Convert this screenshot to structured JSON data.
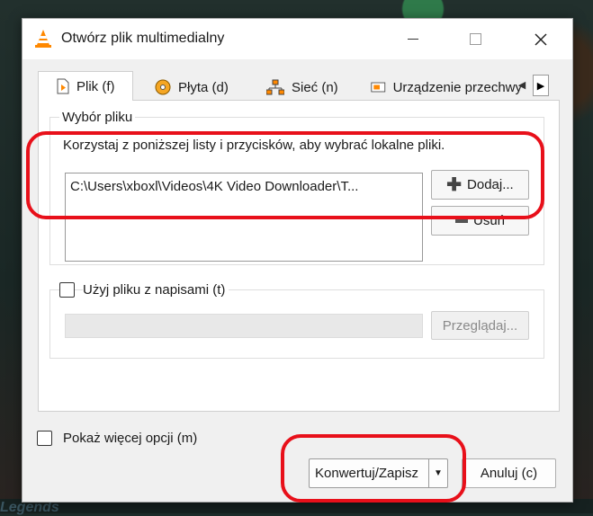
{
  "window": {
    "title": "Otwórz plik multimedialny"
  },
  "tabs": [
    {
      "label": "Plik (f)",
      "icon": "file-icon"
    },
    {
      "label": "Płyta (d)",
      "icon": "disc-icon"
    },
    {
      "label": "Sieć (n)",
      "icon": "network-icon"
    },
    {
      "label": "Urządzenie przechwy",
      "icon": "capture-icon"
    }
  ],
  "file_group": {
    "label": "Wybór pliku",
    "hint": "Korzystaj z poniższej listy i przycisków, aby wybrać lokalne pliki.",
    "files": [
      "C:\\Users\\xboxl\\Videos\\4K Video Downloader\\T..."
    ],
    "add_label": "Dodaj...",
    "remove_label": "Usuń"
  },
  "subtitle_group": {
    "checkbox_label": "Użyj pliku z napisami (t)",
    "checked": false,
    "browse_label": "Przeglądaj..."
  },
  "more_options": {
    "label": "Pokaż więcej opcji (m)",
    "checked": false
  },
  "footer": {
    "convert_label": "Konwertuj/Zapisz",
    "cancel_label": "Anuluj (c)"
  },
  "background": {
    "text": "Legends"
  },
  "colors": {
    "annotation": "#e8101a",
    "accent": "#ff8800"
  }
}
